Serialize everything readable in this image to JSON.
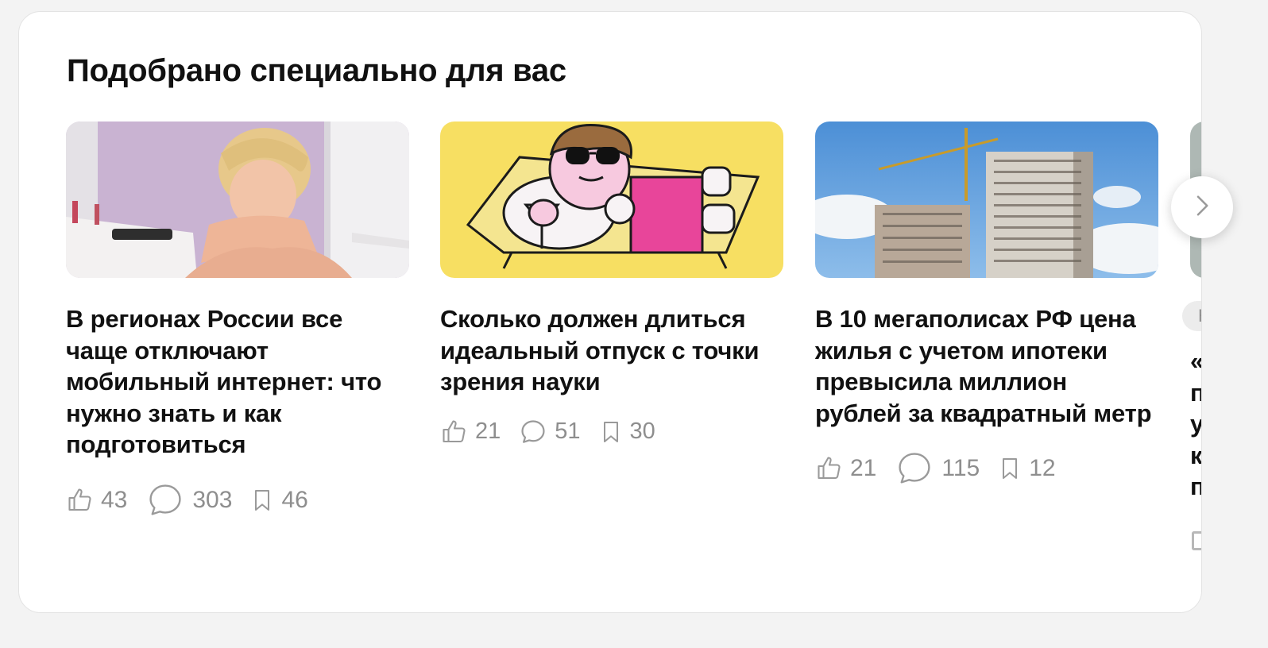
{
  "section": {
    "title": "Подобрано специально для вас"
  },
  "cards": [
    {
      "title": "В регионах России все чаще отключают мобильный интернет: что нужно знать и как подготовиться",
      "likes": "43",
      "comments": "303",
      "bookmarks": "46"
    },
    {
      "title": "Сколько должен длиться идеальный отпуск с точки зрения науки",
      "likes": "21",
      "comments": "51",
      "bookmarks": "30"
    },
    {
      "title": "В 10 мегаполисах РФ цена жилья с учетом ипотеки превысила миллион рублей за квадратный метр",
      "likes": "21",
      "comments": "115",
      "bookmarks": "12"
    }
  ],
  "peek": {
    "badge": "Н",
    "lines": [
      "«",
      "п",
      "у",
      "к",
      "п"
    ]
  },
  "icons": {
    "like": "thumbs-up-icon",
    "comment": "comment-bubble-icon",
    "bookmark": "bookmark-icon",
    "next": "chevron-right-icon"
  },
  "colors": {
    "text": "#111111",
    "muted": "#8e8e8e",
    "panel": "#ffffff",
    "page": "#f3f3f3"
  }
}
